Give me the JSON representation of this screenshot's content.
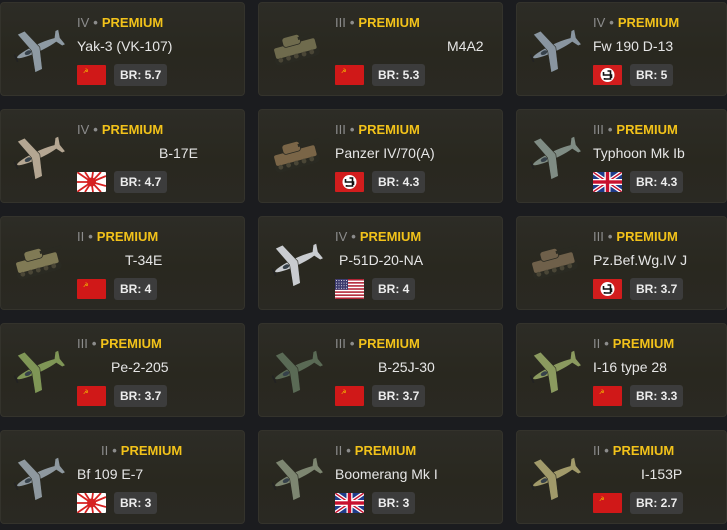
{
  "rank_dot": "•",
  "premium_label": "PREMIUM",
  "cards": [
    {
      "tier": "IV",
      "name": "Yak-3 (VK-107)",
      "nation": "ussr",
      "br": "BR: 5.7",
      "type": "plane",
      "color": "#8e9aa3",
      "icon": "plane-icon"
    },
    {
      "tier": "III",
      "name": "M4A2",
      "nation": "ussr",
      "br": "BR: 5.3",
      "type": "tank",
      "color": "#6f6b4d",
      "icon": "tank-icon"
    },
    {
      "tier": "IV",
      "name": "Fw 190 D-13",
      "nation": "germany",
      "br": "BR: 5",
      "type": "plane",
      "color": "#8995a0",
      "icon": "plane-icon"
    },
    {
      "tier": "IV",
      "name": "B-17E",
      "nation": "japan",
      "br": "BR: 4.7",
      "type": "plane",
      "color": "#b4a692",
      "icon": "bomber-icon"
    },
    {
      "tier": "III",
      "name": "Panzer IV/70(A)",
      "nation": "germany",
      "br": "BR: 4.3",
      "type": "tank",
      "color": "#7a6547",
      "icon": "tank-destroyer-icon"
    },
    {
      "tier": "III",
      "name": "Typhoon Mk Ib",
      "nation": "britain",
      "br": "BR: 4.3",
      "type": "plane",
      "color": "#7f8c84",
      "icon": "plane-icon"
    },
    {
      "tier": "II",
      "name": "T-34E",
      "nation": "ussr",
      "br": "BR: 4",
      "type": "tank",
      "color": "#807a55",
      "icon": "tank-icon"
    },
    {
      "tier": "IV",
      "name": "P-51D-20-NA",
      "nation": "usa",
      "br": "BR: 4",
      "type": "plane",
      "color": "#c9ccd0",
      "icon": "plane-icon"
    },
    {
      "tier": "III",
      "name": "Pz.Bef.Wg.IV J",
      "nation": "germany",
      "br": "BR: 3.7",
      "type": "tank",
      "color": "#6f604a",
      "icon": "tank-icon"
    },
    {
      "tier": "III",
      "name": "Pe-2-205",
      "nation": "ussr",
      "br": "BR: 3.7",
      "type": "plane",
      "color": "#7f9656",
      "icon": "bomber-icon"
    },
    {
      "tier": "III",
      "name": "B-25J-30",
      "nation": "ussr",
      "br": "BR: 3.7",
      "type": "plane",
      "color": "#5a6a55",
      "icon": "bomber-icon"
    },
    {
      "tier": "II",
      "name": "I-16 type 28",
      "nation": "ussr",
      "br": "BR: 3.3",
      "type": "plane",
      "color": "#8b9a5f",
      "icon": "plane-icon"
    },
    {
      "tier": "II",
      "name": "Bf 109 E-7",
      "nation": "japan",
      "br": "BR: 3",
      "type": "plane",
      "color": "#8e989f",
      "icon": "plane-icon"
    },
    {
      "tier": "II",
      "name": "Boomerang Mk I",
      "nation": "britain",
      "br": "BR: 3",
      "type": "plane",
      "color": "#7d8671",
      "icon": "plane-icon"
    },
    {
      "tier": "II",
      "name": "I-153P",
      "nation": "ussr",
      "br": "BR: 2.7",
      "type": "plane",
      "color": "#a19a6a",
      "icon": "biplane-icon"
    }
  ]
}
